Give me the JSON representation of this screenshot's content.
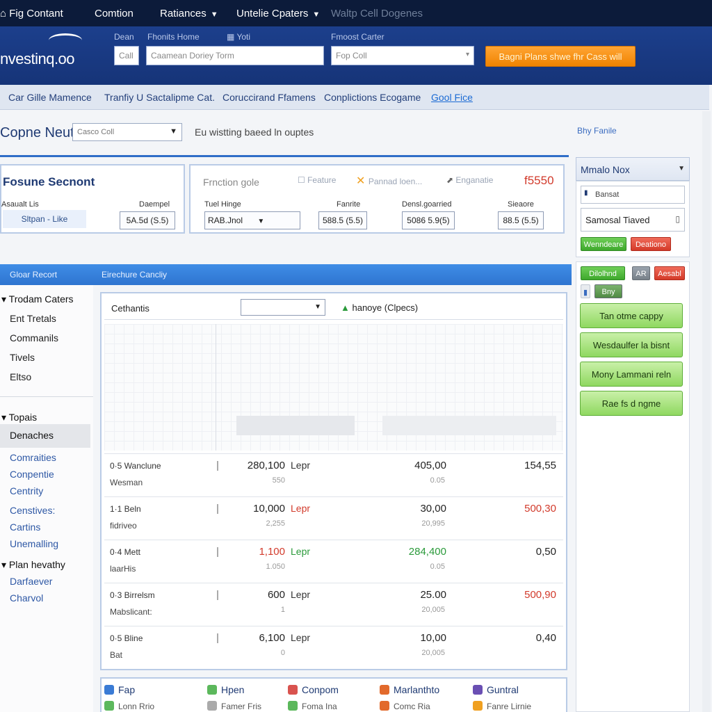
{
  "topbar": {
    "items": [
      "Fig Contant",
      "Comtion",
      "Ratiances",
      "Untelie Cpaters",
      "Waltp Cell Dogenes"
    ]
  },
  "header": {
    "logo": "nvestinq.oo",
    "labels": [
      "Dean",
      "Fhonits Home",
      "Yoti",
      "Fmoost Carter"
    ],
    "input_small": "Call",
    "input_main_placeholder": "Caamean Doriey Torm",
    "select_value": "Fop Coll",
    "cta_label": "Bagni Plans shwe fhr Cass will"
  },
  "nav": {
    "items": [
      "Car Gille Mamence",
      "Tranfiy U Sactalipme Cat.",
      "Coruccirand Ffamens",
      "Conplictions Ecogame",
      "Gool Fice"
    ]
  },
  "title_row": {
    "title": "Copne Neut",
    "select_value": "Casco Coll",
    "note": "Eu wistting baeed ln ouptes",
    "right_link": "Bhy Fanile"
  },
  "summary": {
    "title": "Fosune Secnont",
    "left_label": "Asaualt Lis",
    "left_value": "Sltpan - Like",
    "left_label2": "Daempel",
    "left_box": "5A.5d (S.5)",
    "filter_label": "Frnction gole",
    "tools": [
      "Feature",
      "Pannad loen...",
      "Enganatie"
    ],
    "price": "f5550",
    "col_labels": [
      "Tuel Hinge",
      "Fanrite",
      "Densl.goarried",
      "Sieaore"
    ],
    "select_value": "RAB.Jnol",
    "boxes": [
      "588.5 (5.5)",
      "5086 5.9(5)",
      "88.5 (5.5)"
    ]
  },
  "section_bar": {
    "left": "Gloar Recort",
    "center": "Eirechure Cancliy"
  },
  "left_panel": {
    "group1_head": "Trodam Caters",
    "group1_items": [
      "Ent Tretals",
      "Commanils",
      "Tivels",
      "Eltso"
    ],
    "group2_head": "Topais",
    "group2_selected": "Denaches",
    "group2_items": [
      "Comraities",
      "Conpentie",
      "Centrity",
      "Censtives:",
      "Cartins",
      "Unemalling"
    ],
    "group3_head": "Plan hevathy",
    "group3_items": [
      "Darfaever",
      "Charvol"
    ]
  },
  "main": {
    "filter_label": "Cethantis",
    "filter_select": "",
    "filter_note": "hanoye (Clpecs)",
    "rows": [
      {
        "name": "0·5 Wanclune",
        "sub": "Wesman",
        "v1": "280,100",
        "v1_color": "",
        "unit": "Lepr",
        "unit_color": "",
        "v1s": "550",
        "v2": "405,00",
        "v2_color": "",
        "v2s": "0.05",
        "v3": "154,55",
        "v3_color": ""
      },
      {
        "name": "1·1 Beln",
        "sub": "fidriveo",
        "v1": "10,000",
        "v1_color": "",
        "unit": "Lepr",
        "unit_color": "red",
        "v1s": "2,255",
        "v2": "30,00",
        "v2_color": "",
        "v2s": "20,995",
        "v3": "500,30",
        "v3_color": "red"
      },
      {
        "name": "0·4 Mett",
        "sub": "laarHis",
        "v1": "1,100",
        "v1_color": "red",
        "unit": "Lepr",
        "unit_color": "green",
        "v1s": "1.050",
        "v2": "284,400",
        "v2_color": "green",
        "v2s": "0.05",
        "v3": "0,50",
        "v3_color": ""
      },
      {
        "name": "0·3 Birrelsm",
        "sub": "Mabslicant:",
        "v1": "600",
        "v1_color": "",
        "unit": "Lepr",
        "unit_color": "",
        "v1s": "1",
        "v2": "25.00",
        "v2_color": "",
        "v2s": "20,005",
        "v3": "500,90",
        "v3_color": "red"
      },
      {
        "name": "0·5 Bline",
        "sub": "Bat",
        "v1": "6,100",
        "v1_color": "",
        "unit": "Lepr",
        "unit_color": "",
        "v1s": "0",
        "v2": "10,00",
        "v2_color": "",
        "v2s": "20,005",
        "v3": "0,40",
        "v3_color": ""
      }
    ]
  },
  "shortcuts": {
    "row1": [
      {
        "label": "Fap",
        "icon": "globe-icon",
        "color": "#3a7bd5"
      },
      {
        "label": "Hpen",
        "icon": "leaf-icon",
        "color": "#5cb85c"
      },
      {
        "label": "Conpom",
        "icon": "target-icon",
        "color": "#d9534f"
      },
      {
        "label": "Marlanthto",
        "icon": "chart-icon",
        "color": "#e26a2c"
      },
      {
        "label": "Guntral",
        "icon": "book-icon",
        "color": "#6a4fb3"
      }
    ],
    "row2": [
      {
        "label": "Lonn Rrio",
        "icon": "tree-icon",
        "color": "#5cb85c"
      },
      {
        "label": "Famer Fris",
        "icon": "doc-icon",
        "color": "#aaa"
      },
      {
        "label": "Foma Ina",
        "icon": "check-icon",
        "color": "#5cb85c"
      },
      {
        "label": "Comc Ria",
        "icon": "box-icon",
        "color": "#e26a2c"
      },
      {
        "label": "Fanre Lirnie",
        "icon": "flame-icon",
        "color": "#f0a020"
      }
    ]
  },
  "sidebar": {
    "dropdown": "Mmalo Nox",
    "mini_input": "Bansat",
    "main_value": "Samosal Tiaved",
    "btn_green": "Wenndeare",
    "btn_red": "Deationo",
    "tags": [
      "Dilolhnd",
      "AR",
      "Aesabl",
      "Bny"
    ],
    "buttons": [
      "Tan otme cappy",
      "Wesdaulfer la bisnt",
      "Mony Lammani reln",
      "Rae fs d ngme"
    ]
  },
  "colors": {
    "topbar": "#0c1b3a",
    "header": "#1c3f8c",
    "accent": "#2f6ec8",
    "cta": "#f08300",
    "positive": "#2a9a3a",
    "negative": "#d23a2b"
  }
}
